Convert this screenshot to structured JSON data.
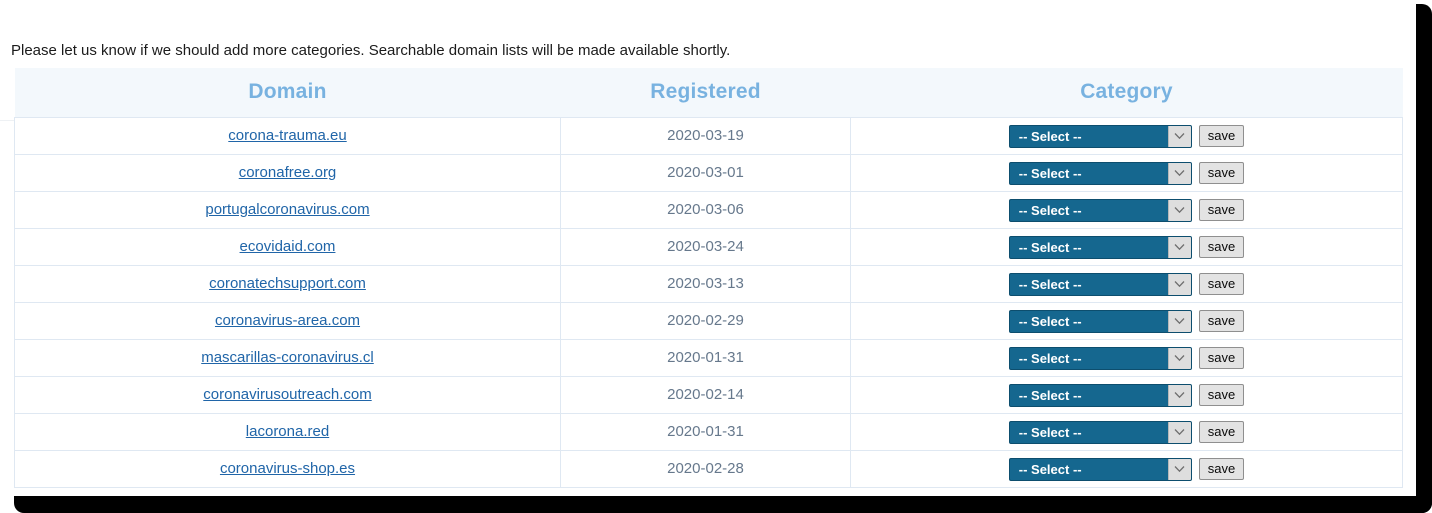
{
  "intro": {
    "text": "Please let us know if we should add more categories. Searchable domain lists will be made available shortly."
  },
  "table": {
    "headers": {
      "domain": "Domain",
      "registered": "Registered",
      "category": "Category"
    },
    "select_placeholder": "-- Select --",
    "save_label": "save",
    "rows": [
      {
        "domain": "corona-trauma.eu",
        "registered": "2020-03-19",
        "category": "-- Select --",
        "save": "save"
      },
      {
        "domain": "coronafree.org",
        "registered": "2020-03-01",
        "category": "-- Select --",
        "save": "save"
      },
      {
        "domain": "portugalcoronavirus.com",
        "registered": "2020-03-06",
        "category": "-- Select --",
        "save": "save"
      },
      {
        "domain": "ecovidaid.com",
        "registered": "2020-03-24",
        "category": "-- Select --",
        "save": "save"
      },
      {
        "domain": "coronatechsupport.com",
        "registered": "2020-03-13",
        "category": "-- Select --",
        "save": "save"
      },
      {
        "domain": "coronavirus-area.com",
        "registered": "2020-02-29",
        "category": "-- Select --",
        "save": "save"
      },
      {
        "domain": "mascarillas-coronavirus.cl",
        "registered": "2020-01-31",
        "category": "-- Select --",
        "save": "save"
      },
      {
        "domain": "coronavirusoutreach.com",
        "registered": "2020-02-14",
        "category": "-- Select --",
        "save": "save"
      },
      {
        "domain": "lacorona.red",
        "registered": "2020-01-31",
        "category": "-- Select --",
        "save": "save"
      },
      {
        "domain": "coronavirus-shop.es",
        "registered": "2020-02-28",
        "category": "-- Select --",
        "save": "save"
      }
    ]
  },
  "colors": {
    "header_text": "#78b2e0",
    "header_bg": "#f3f8fc",
    "link": "#2065a8",
    "date_text": "#66788c",
    "select_bg": "#15678f",
    "grid_line": "#dfe8f2",
    "frame": "#000000"
  }
}
